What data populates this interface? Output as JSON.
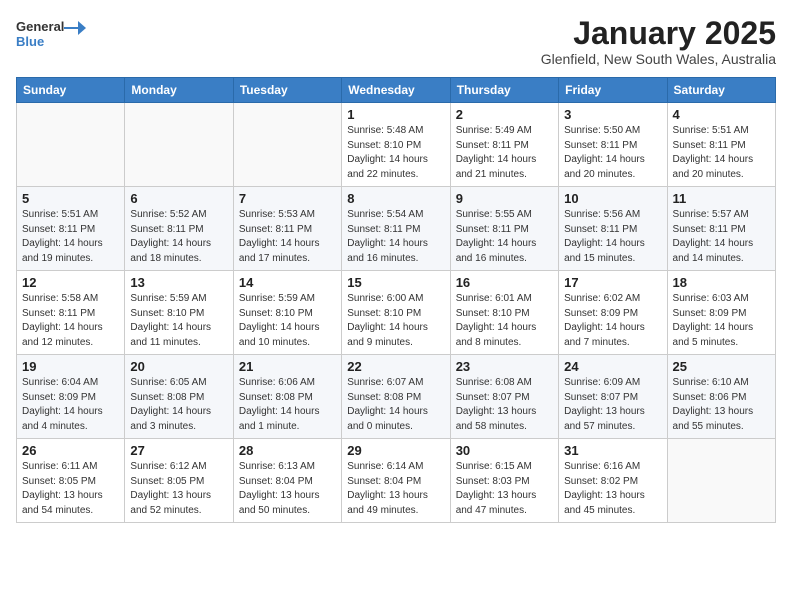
{
  "header": {
    "logo_line1": "General",
    "logo_line2": "Blue",
    "title": "January 2025",
    "subtitle": "Glenfield, New South Wales, Australia"
  },
  "columns": [
    "Sunday",
    "Monday",
    "Tuesday",
    "Wednesday",
    "Thursday",
    "Friday",
    "Saturday"
  ],
  "weeks": [
    [
      {
        "day": "",
        "info": ""
      },
      {
        "day": "",
        "info": ""
      },
      {
        "day": "",
        "info": ""
      },
      {
        "day": "1",
        "info": "Sunrise: 5:48 AM\nSunset: 8:10 PM\nDaylight: 14 hours\nand 22 minutes."
      },
      {
        "day": "2",
        "info": "Sunrise: 5:49 AM\nSunset: 8:11 PM\nDaylight: 14 hours\nand 21 minutes."
      },
      {
        "day": "3",
        "info": "Sunrise: 5:50 AM\nSunset: 8:11 PM\nDaylight: 14 hours\nand 20 minutes."
      },
      {
        "day": "4",
        "info": "Sunrise: 5:51 AM\nSunset: 8:11 PM\nDaylight: 14 hours\nand 20 minutes."
      }
    ],
    [
      {
        "day": "5",
        "info": "Sunrise: 5:51 AM\nSunset: 8:11 PM\nDaylight: 14 hours\nand 19 minutes."
      },
      {
        "day": "6",
        "info": "Sunrise: 5:52 AM\nSunset: 8:11 PM\nDaylight: 14 hours\nand 18 minutes."
      },
      {
        "day": "7",
        "info": "Sunrise: 5:53 AM\nSunset: 8:11 PM\nDaylight: 14 hours\nand 17 minutes."
      },
      {
        "day": "8",
        "info": "Sunrise: 5:54 AM\nSunset: 8:11 PM\nDaylight: 14 hours\nand 16 minutes."
      },
      {
        "day": "9",
        "info": "Sunrise: 5:55 AM\nSunset: 8:11 PM\nDaylight: 14 hours\nand 16 minutes."
      },
      {
        "day": "10",
        "info": "Sunrise: 5:56 AM\nSunset: 8:11 PM\nDaylight: 14 hours\nand 15 minutes."
      },
      {
        "day": "11",
        "info": "Sunrise: 5:57 AM\nSunset: 8:11 PM\nDaylight: 14 hours\nand 14 minutes."
      }
    ],
    [
      {
        "day": "12",
        "info": "Sunrise: 5:58 AM\nSunset: 8:11 PM\nDaylight: 14 hours\nand 12 minutes."
      },
      {
        "day": "13",
        "info": "Sunrise: 5:59 AM\nSunset: 8:10 PM\nDaylight: 14 hours\nand 11 minutes."
      },
      {
        "day": "14",
        "info": "Sunrise: 5:59 AM\nSunset: 8:10 PM\nDaylight: 14 hours\nand 10 minutes."
      },
      {
        "day": "15",
        "info": "Sunrise: 6:00 AM\nSunset: 8:10 PM\nDaylight: 14 hours\nand 9 minutes."
      },
      {
        "day": "16",
        "info": "Sunrise: 6:01 AM\nSunset: 8:10 PM\nDaylight: 14 hours\nand 8 minutes."
      },
      {
        "day": "17",
        "info": "Sunrise: 6:02 AM\nSunset: 8:09 PM\nDaylight: 14 hours\nand 7 minutes."
      },
      {
        "day": "18",
        "info": "Sunrise: 6:03 AM\nSunset: 8:09 PM\nDaylight: 14 hours\nand 5 minutes."
      }
    ],
    [
      {
        "day": "19",
        "info": "Sunrise: 6:04 AM\nSunset: 8:09 PM\nDaylight: 14 hours\nand 4 minutes."
      },
      {
        "day": "20",
        "info": "Sunrise: 6:05 AM\nSunset: 8:08 PM\nDaylight: 14 hours\nand 3 minutes."
      },
      {
        "day": "21",
        "info": "Sunrise: 6:06 AM\nSunset: 8:08 PM\nDaylight: 14 hours\nand 1 minute."
      },
      {
        "day": "22",
        "info": "Sunrise: 6:07 AM\nSunset: 8:08 PM\nDaylight: 14 hours\nand 0 minutes."
      },
      {
        "day": "23",
        "info": "Sunrise: 6:08 AM\nSunset: 8:07 PM\nDaylight: 13 hours\nand 58 minutes."
      },
      {
        "day": "24",
        "info": "Sunrise: 6:09 AM\nSunset: 8:07 PM\nDaylight: 13 hours\nand 57 minutes."
      },
      {
        "day": "25",
        "info": "Sunrise: 6:10 AM\nSunset: 8:06 PM\nDaylight: 13 hours\nand 55 minutes."
      }
    ],
    [
      {
        "day": "26",
        "info": "Sunrise: 6:11 AM\nSunset: 8:05 PM\nDaylight: 13 hours\nand 54 minutes."
      },
      {
        "day": "27",
        "info": "Sunrise: 6:12 AM\nSunset: 8:05 PM\nDaylight: 13 hours\nand 52 minutes."
      },
      {
        "day": "28",
        "info": "Sunrise: 6:13 AM\nSunset: 8:04 PM\nDaylight: 13 hours\nand 50 minutes."
      },
      {
        "day": "29",
        "info": "Sunrise: 6:14 AM\nSunset: 8:04 PM\nDaylight: 13 hours\nand 49 minutes."
      },
      {
        "day": "30",
        "info": "Sunrise: 6:15 AM\nSunset: 8:03 PM\nDaylight: 13 hours\nand 47 minutes."
      },
      {
        "day": "31",
        "info": "Sunrise: 6:16 AM\nSunset: 8:02 PM\nDaylight: 13 hours\nand 45 minutes."
      },
      {
        "day": "",
        "info": ""
      }
    ]
  ]
}
